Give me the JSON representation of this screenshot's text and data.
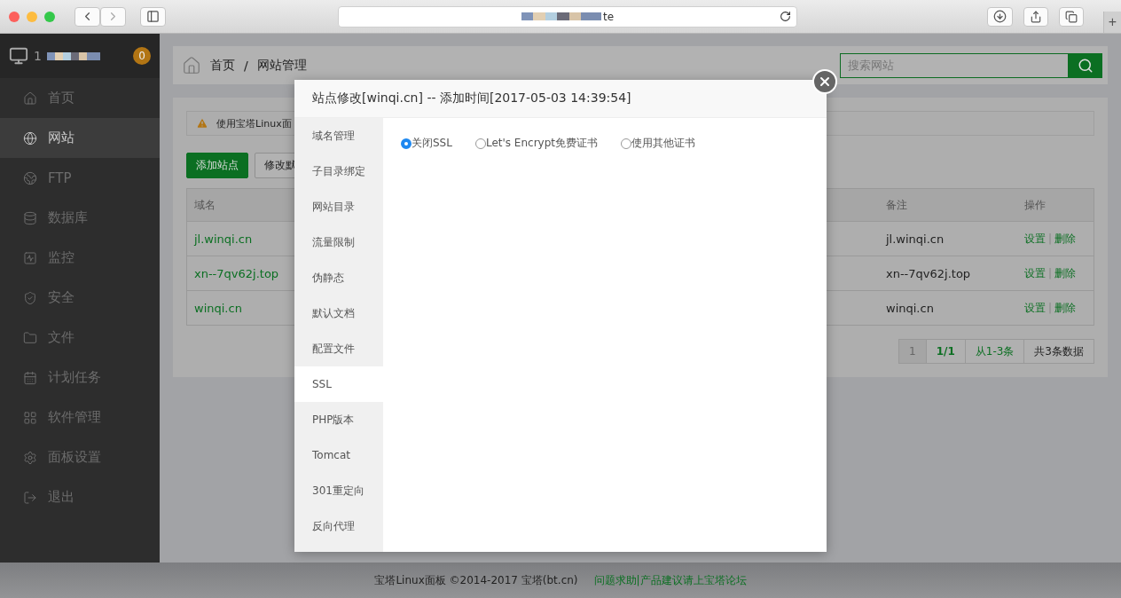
{
  "browser": {
    "url_text": "te",
    "new_tab": "+"
  },
  "sidebar": {
    "server": {
      "name": "1",
      "badge": "0"
    },
    "items": [
      {
        "label": "首页",
        "selected": false
      },
      {
        "label": "网站",
        "selected": true
      },
      {
        "label": "FTP",
        "selected": false
      },
      {
        "label": "数据库",
        "selected": false
      },
      {
        "label": "监控",
        "selected": false
      },
      {
        "label": "安全",
        "selected": false
      },
      {
        "label": "文件",
        "selected": false
      },
      {
        "label": "计划任务",
        "selected": false
      },
      {
        "label": "软件管理",
        "selected": false
      },
      {
        "label": "面板设置",
        "selected": false
      },
      {
        "label": "退出",
        "selected": false
      }
    ]
  },
  "breadcrumb": {
    "items": [
      "首页",
      "网站管理"
    ],
    "separator": "/"
  },
  "search": {
    "placeholder": "搜索网站"
  },
  "alert": {
    "text": "使用宝塔Linux面"
  },
  "buttons": [
    {
      "label": "添加站点",
      "kind": "primary"
    },
    {
      "label": "修改默",
      "kind": "default"
    }
  ],
  "table": {
    "columns": [
      "域名",
      "备注",
      "操作"
    ],
    "rows": [
      {
        "domain": "jl.winqi.cn",
        "note": "jl.winqi.cn",
        "actions": [
          "设置",
          "删除"
        ]
      },
      {
        "domain": "xn--7qv62j.top",
        "note": "xn--7qv62j.top",
        "actions": [
          "设置",
          "删除"
        ]
      },
      {
        "domain": "winqi.cn",
        "note": "winqi.cn",
        "actions": [
          "设置",
          "删除"
        ]
      }
    ],
    "action_separator": "|"
  },
  "pagination": [
    {
      "label": "1",
      "kind": "page",
      "selected": true
    },
    {
      "label": "1/1",
      "kind": "strong",
      "selected": false
    },
    {
      "label": "从1-3条",
      "kind": "link",
      "selected": false
    },
    {
      "label": "共3条数据",
      "kind": "info",
      "selected": false
    }
  ],
  "modal": {
    "title": "站点修改[winqi.cn] -- 添加时间[2017-05-03 14:39:54]",
    "tabs": [
      {
        "label": "域名管理",
        "selected": false
      },
      {
        "label": "子目录绑定",
        "selected": false
      },
      {
        "label": "网站目录",
        "selected": false
      },
      {
        "label": "流量限制",
        "selected": false
      },
      {
        "label": "伪静态",
        "selected": false
      },
      {
        "label": "默认文档",
        "selected": false
      },
      {
        "label": "配置文件",
        "selected": false
      },
      {
        "label": "SSL",
        "selected": true
      },
      {
        "label": "PHP版本",
        "selected": false
      },
      {
        "label": "Tomcat",
        "selected": false
      },
      {
        "label": "301重定向",
        "selected": false
      },
      {
        "label": "反向代理",
        "selected": false
      }
    ],
    "ssl_options": [
      {
        "label": "关闭SSL",
        "selected": true
      },
      {
        "label": "Let's Encrypt免费证书",
        "selected": false
      },
      {
        "label": "使用其他证书",
        "selected": false
      }
    ]
  },
  "footer": {
    "text": "宝塔Linux面板 ©2014-2017 宝塔(bt.cn)",
    "link": "问题求助|产品建议请上宝塔论坛"
  }
}
